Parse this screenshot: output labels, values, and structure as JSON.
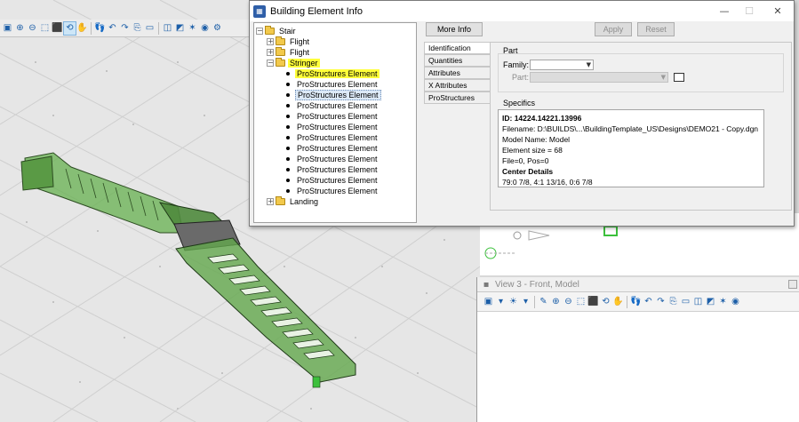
{
  "dialog": {
    "title": "Building Element Info",
    "more_info_label": "More Info",
    "apply_label": "Apply",
    "reset_label": "Reset"
  },
  "tree": {
    "root": "Stair",
    "items": [
      {
        "label": "Flight",
        "type": "folder"
      },
      {
        "label": "Flight",
        "type": "folder"
      },
      {
        "label": "Stringer",
        "type": "folder-open"
      },
      {
        "label": "ProStructures Element",
        "type": "leaf",
        "state": "highlighted"
      },
      {
        "label": "ProStructures Element",
        "type": "leaf"
      },
      {
        "label": "ProStructures Element",
        "type": "leaf",
        "state": "selected"
      },
      {
        "label": "ProStructures Element",
        "type": "leaf"
      },
      {
        "label": "ProStructures Element",
        "type": "leaf"
      },
      {
        "label": "ProStructures Element",
        "type": "leaf"
      },
      {
        "label": "ProStructures Element",
        "type": "leaf"
      },
      {
        "label": "ProStructures Element",
        "type": "leaf"
      },
      {
        "label": "ProStructures Element",
        "type": "leaf"
      },
      {
        "label": "ProStructures Element",
        "type": "leaf"
      },
      {
        "label": "ProStructures Element",
        "type": "leaf"
      },
      {
        "label": "ProStructures Element",
        "type": "leaf"
      },
      {
        "label": "Landing",
        "type": "folder"
      }
    ]
  },
  "tabs": [
    "Identification",
    "Quantities",
    "Attributes",
    "X Attributes",
    "ProStructures"
  ],
  "part": {
    "group_label": "Part",
    "family_label": "Family:",
    "part_label": "Part:"
  },
  "specifics": {
    "group_label": "Specifics",
    "id_line": "ID: 14224.14221.13996",
    "filename_line": "Filename: D:\\BUILDS\\...\\BuildingTemplate_US\\Designs\\DEMO21 - Copy.dgn",
    "model_line": "Model Name: Model",
    "size_line": "Element size = 68",
    "file_line": "File=0, Pos=0",
    "center_heading": "Center Details",
    "center_values": "79:0 7/8, 4:1 13/16, 0:6 7/8"
  },
  "view3": {
    "title": "View 3 - Front, Model"
  },
  "colors": {
    "highlight": "#ffff3a",
    "stair_green": "#5fa84a",
    "selected_row": "#dce9f7"
  }
}
